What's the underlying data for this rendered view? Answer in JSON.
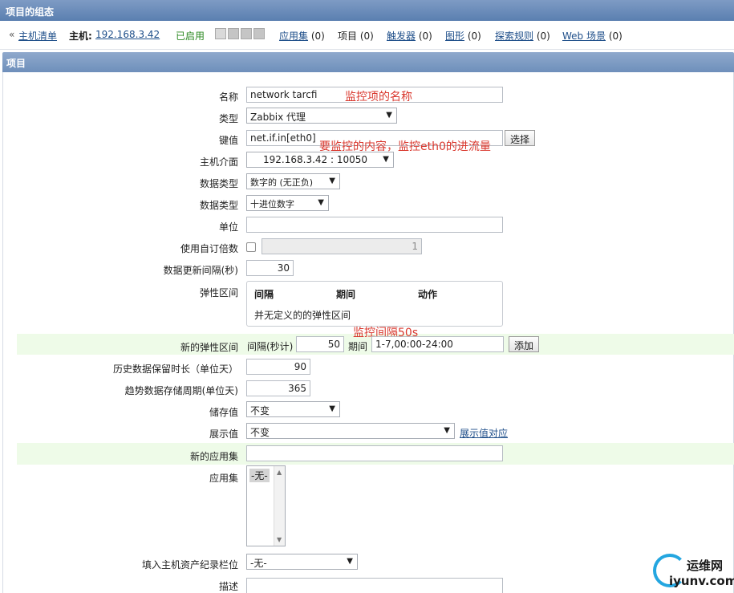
{
  "titlebar": {
    "title": "项目的组态"
  },
  "nav": {
    "host_list_prefix": "«",
    "host_list": "主机清单",
    "host_label": "主机:",
    "host_ip": "192.168.3.42",
    "host_status": "已启用",
    "status_icons": [
      "zabbix-availability-icon",
      "snmp-availability-icon",
      "jmx-availability-icon",
      "ipmi-availability-icon"
    ],
    "links": [
      {
        "label": "应用集",
        "count": "(0)"
      },
      {
        "label": "项目",
        "count": "(0)"
      },
      {
        "label": "触发器",
        "count": "(0)"
      },
      {
        "label": "图形",
        "count": "(0)"
      },
      {
        "label": "探索规则",
        "count": "(0)"
      },
      {
        "label": "Web 场景",
        "count": "(0)"
      }
    ]
  },
  "section": {
    "title": "项目"
  },
  "form": {
    "name": {
      "label": "名称",
      "value": "network tarcfi"
    },
    "type": {
      "label": "类型",
      "value": "Zabbix 代理"
    },
    "key": {
      "label": "键值",
      "value": "net.if.in[eth0]",
      "button": "选择"
    },
    "host_interface": {
      "label": "主机介面",
      "value": "192.168.3.42 : 10050"
    },
    "info_type": {
      "label": "数据类型",
      "value": "数字的 (无正负)"
    },
    "data_type": {
      "label": "数据类型",
      "value": "十进位数字"
    },
    "units": {
      "label": "单位",
      "value": ""
    },
    "multiplier": {
      "label": "使用自订倍数",
      "value": "1"
    },
    "delay": {
      "label": "数据更新间隔(秒)",
      "value": "30"
    },
    "flex": {
      "label": "弹性区间",
      "headers": [
        "间隔",
        "期间",
        "动作"
      ],
      "empty": "并无定义的的弹性区间"
    },
    "new_flex": {
      "label": "新的弹性区间",
      "interval_label": "间隔(秒计)",
      "interval_value": "50",
      "period_label": "期间",
      "period_value": "1-7,00:00-24:00",
      "add_button": "添加"
    },
    "history": {
      "label": "历史数据保留时长（单位天）",
      "value": "90"
    },
    "trends": {
      "label": "趋势数据存储周期(单位天)",
      "value": "365"
    },
    "store_value": {
      "label": "储存值",
      "value": "不变"
    },
    "show_value": {
      "label": "展示值",
      "value": "不变",
      "link": "展示值对应"
    },
    "new_application": {
      "label": "新的应用集",
      "value": ""
    },
    "applications": {
      "label": "应用集",
      "options": [
        "-无-"
      ]
    },
    "inventory": {
      "label": "填入主机资产纪录栏位",
      "value": "-无-"
    },
    "description": {
      "label": "描述",
      "value": ""
    }
  },
  "annotations": {
    "name_note": "监控项的名称",
    "key_note": "要监控的内容，监控eth0的进流量",
    "flex_note": "监控间隔50s"
  },
  "watermark": {
    "line1": "运维网",
    "line2": "iyunv.com"
  },
  "colors": {
    "title_bar": "#5a7fb0",
    "annotation": "#d9372d",
    "highlight_row": "#eefbe8",
    "link": "#1f4f8a"
  }
}
